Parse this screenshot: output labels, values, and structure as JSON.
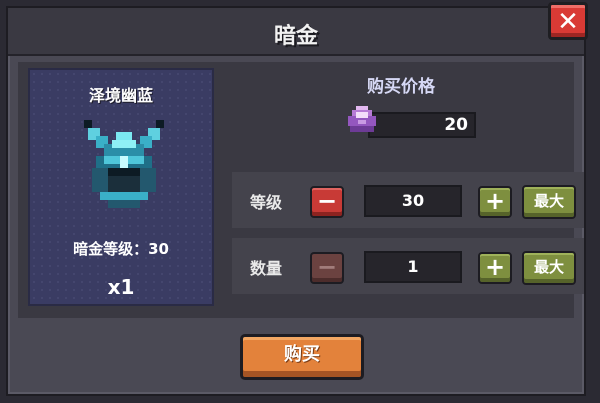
{
  "dialog": {
    "title": "暗金",
    "close_label": "✕"
  },
  "item": {
    "name": "泽境幽蓝",
    "level_text": "暗金等级：30",
    "quantity_text": "x1",
    "icon": "blue-horned-helmet-icon"
  },
  "price": {
    "title": "购买价格",
    "currency_icon": "purple-gem-icon",
    "value": "20"
  },
  "level_row": {
    "label": "等级",
    "minus_label": "−",
    "value": "30",
    "plus_label": "+",
    "max_label": "最大"
  },
  "quantity_row": {
    "label": "数量",
    "minus_label": "−",
    "value": "1",
    "plus_label": "+",
    "max_label": "最大"
  },
  "buy_button": {
    "label": "购买"
  },
  "colors": {
    "accent_orange": "#e3823b",
    "close_red": "#d93a35",
    "plus_green": "#7e8f3f",
    "card_blue": "#3a3c63"
  }
}
